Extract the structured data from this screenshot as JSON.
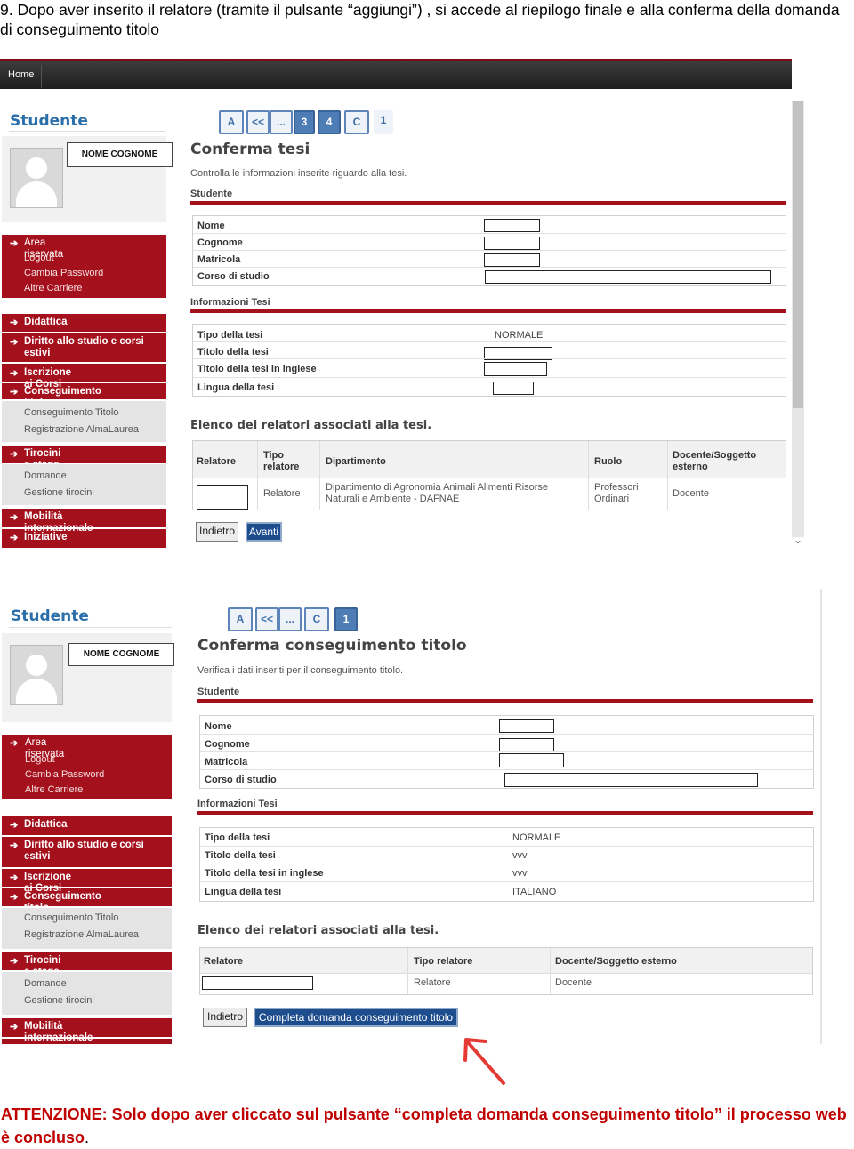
{
  "intro": "9. Dopo aver inserito il relatore (tramite il pulsante “aggiungi”) , si accede al riepilogo finale e alla conferma della domanda di conseguimento titolo",
  "common": {
    "home": "Home",
    "side_title": "Studente",
    "user_name": "NOME COGNOME",
    "menu": {
      "area": "Area riservata",
      "logout": "Logout",
      "password": "Cambia Password",
      "carriere": "Altre Carriere",
      "didattica": "Didattica",
      "diritto": "Diritto allo studio e corsi estivi",
      "iscrizione": "Iscrizione ai Corsi",
      "conseguimento": "Conseguimento titolo",
      "cons_sub1": "Conseguimento Titolo",
      "cons_sub2": "Registrazione AlmaLaurea",
      "tirocini": "Tirocini e stage",
      "tir_sub1": "Domande",
      "tir_sub2": "Gestione tirocini",
      "mobilita": "Mobilità internazionale",
      "iniziative": "Iniziative"
    },
    "labels": {
      "student": "Studente",
      "nome": "Nome",
      "cognome": "Cognome",
      "matricola": "Matricola",
      "corso": "Corso di studio",
      "info": "Informazioni Tesi",
      "tipo": "Tipo della tesi",
      "titolo": "Titolo della tesi",
      "titolo_en": "Titolo della tesi in inglese",
      "lingua": "Lingua della tesi",
      "elenco": "Elenco dei relatori associati alla tesi."
    }
  },
  "screen1": {
    "steps": [
      "A",
      "<<",
      "...",
      "3",
      "4",
      "C",
      "1"
    ],
    "title": "Conferma tesi",
    "subtitle": "Controlla le informazioni inserite riguardo alla tesi.",
    "tipo_value": "NORMALE",
    "relatori_headers": [
      "Relatore",
      "Tipo relatore",
      "Dipartimento",
      "Ruolo",
      "Docente/Soggetto esterno"
    ],
    "relatori_row": {
      "tipo": "Relatore",
      "dipartimento": "Dipartimento di Agronomia Animali Alimenti Risorse Naturali e Ambiente - DAFNAE",
      "ruolo": "Professori Ordinari",
      "docente": "Docente"
    },
    "back_label": "Indietro",
    "next_label": "Avanti"
  },
  "screen2": {
    "steps": [
      "A",
      "<<",
      "...",
      "C",
      "1"
    ],
    "title": "Conferma conseguimento titolo",
    "subtitle": "Verifica i dati inseriti per il conseguimento titolo.",
    "tipo_value": "NORMALE",
    "titolo_value": "vvv",
    "titolo_en_value": "vvv",
    "lingua_value": "ITALIANO",
    "relatori_headers": [
      "Relatore",
      "Tipo relatore",
      "Docente/Soggetto esterno"
    ],
    "relatori_row": {
      "tipo": "Relatore",
      "docente": "Docente"
    },
    "back_label": "Indietro",
    "confirm_label": "Completa domanda conseguimento titolo"
  },
  "notice_main": "ATTENZIONE: Solo dopo aver cliccato sul pulsante “completa domanda conseguimento titolo” il processo web è concluso",
  "notice_end": ".",
  "colors": {
    "brand_red": "#a5101d",
    "accent_blue": "#1e4d8e",
    "notice_red": "#c00000",
    "arrow_red": "#e53a33"
  }
}
